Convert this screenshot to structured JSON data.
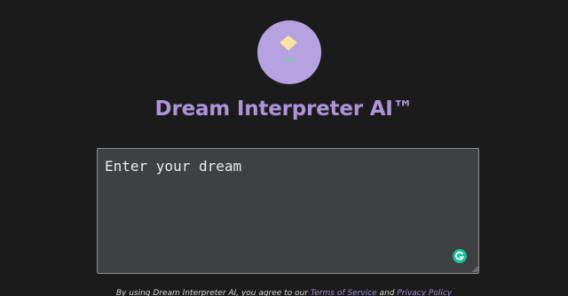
{
  "header": {
    "logo_icon": "dream-crystal-icon",
    "title": "Dream Interpreter AI™"
  },
  "input": {
    "placeholder": "Enter your dream",
    "value": ""
  },
  "widgets": {
    "grammarly_icon": "grammarly-icon"
  },
  "footer": {
    "prefix": "By using Dream Interpreter AI, you agree to our",
    "terms_link": "Terms of Service",
    "conjunction": "and",
    "privacy_link": "Privacy Policy"
  },
  "colors": {
    "background": "#1c1b1c",
    "accent": "#ab94d8",
    "logo_circle": "#b6a2e0",
    "input_background": "#3f4042",
    "grammarly": "#15c39a"
  }
}
